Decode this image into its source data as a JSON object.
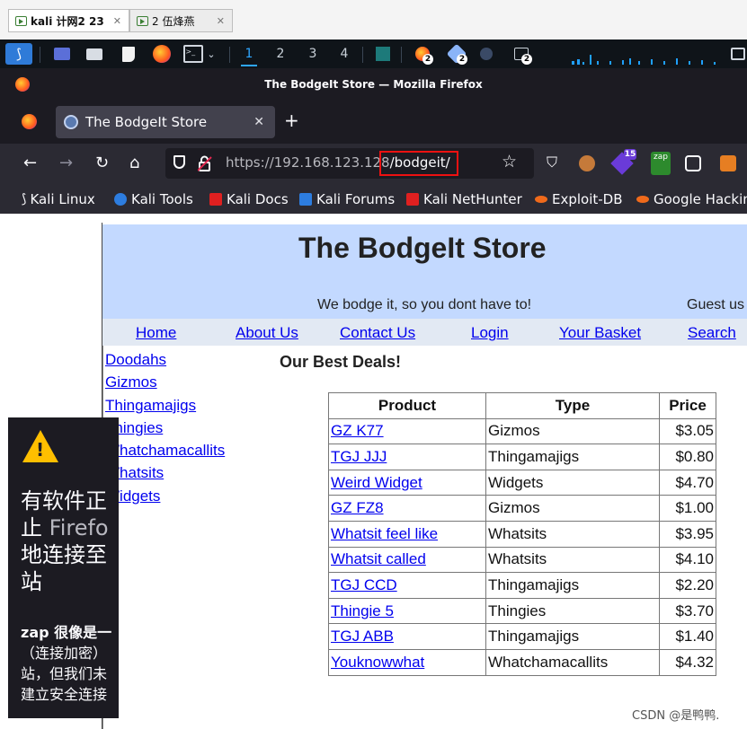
{
  "vm_tabs": [
    {
      "label": "kali 计网2 23",
      "active": true
    },
    {
      "label": "2 伍烽燕",
      "active": false
    }
  ],
  "panel": {
    "workspaces": [
      "1",
      "2",
      "3",
      "4"
    ],
    "active_workspace": "1",
    "badges": [
      "2",
      "2",
      "2"
    ]
  },
  "window": {
    "title": "The BodgeIt Store — Mozilla Firefox"
  },
  "tab": {
    "label": "The BodgeIt Store"
  },
  "urlbar": {
    "url_base": "https://192.168.123.128",
    "url_path": "/bodgeit/"
  },
  "extensions": {
    "badge_15": "15",
    "zap_label": "zap"
  },
  "bookmarks": [
    {
      "label": "Kali Linux",
      "icon": "kali-dragon-icon",
      "color": "#111111"
    },
    {
      "label": "Kali Tools",
      "icon": "kali-tools-icon",
      "color": "#2d7de0"
    },
    {
      "label": "Kali Docs",
      "icon": "kali-docs-icon",
      "color": "#e02020"
    },
    {
      "label": "Kali Forums",
      "icon": "kali-forums-icon",
      "color": "#2d7de0"
    },
    {
      "label": "Kali NetHunter",
      "icon": "nethunter-icon",
      "color": "#e02020"
    },
    {
      "label": "Exploit-DB",
      "icon": "exploit-db-icon",
      "color": "#f06a1b"
    },
    {
      "label": "Google Hacking",
      "icon": "ghdb-icon",
      "color": "#f06a1b"
    }
  ],
  "store": {
    "title": "The BodgeIt Store",
    "tagline": "We bodge it, so you dont have to!",
    "guest": "Guest us",
    "menu": [
      "Home",
      "About Us",
      "Contact Us",
      "Login",
      "Your Basket",
      "Search"
    ],
    "sidebar": [
      "Doodahs",
      "Gizmos",
      "Thingamajigs",
      "Thingies",
      "Whatchamacallits",
      "Whatsits",
      "Widgets"
    ],
    "deals_heading": "Our Best Deals!",
    "table_headers": [
      "Product",
      "Type",
      "Price"
    ],
    "products": [
      {
        "name": "GZ K77",
        "type": "Gizmos",
        "price": "$3.05"
      },
      {
        "name": "TGJ JJJ",
        "type": "Thingamajigs",
        "price": "$0.80"
      },
      {
        "name": "Weird Widget",
        "type": "Widgets",
        "price": "$4.70"
      },
      {
        "name": "GZ FZ8",
        "type": "Gizmos",
        "price": "$1.00"
      },
      {
        "name": "Whatsit feel like",
        "type": "Whatsits",
        "price": "$3.95"
      },
      {
        "name": "Whatsit called",
        "type": "Whatsits",
        "price": "$4.10"
      },
      {
        "name": "TGJ CCD",
        "type": "Thingamajigs",
        "price": "$2.20"
      },
      {
        "name": "Thingie 5",
        "type": "Thingies",
        "price": "$3.70"
      },
      {
        "name": "TGJ ABB",
        "type": "Thingamajigs",
        "price": "$1.40"
      },
      {
        "name": "Youknowwhat",
        "type": "Whatchamacallits",
        "price": "$4.32"
      }
    ]
  },
  "popup": {
    "line1": "有软件正",
    "line2_a": "止",
    "line2_b": " Firefo",
    "line3": "地连接至",
    "line4": "站",
    "body1": "zap 很像是一",
    "body2": "（连接加密）",
    "body3": "站，但我们未",
    "body4": "建立安全连接"
  },
  "watermark": "CSDN @是鸭鸭."
}
